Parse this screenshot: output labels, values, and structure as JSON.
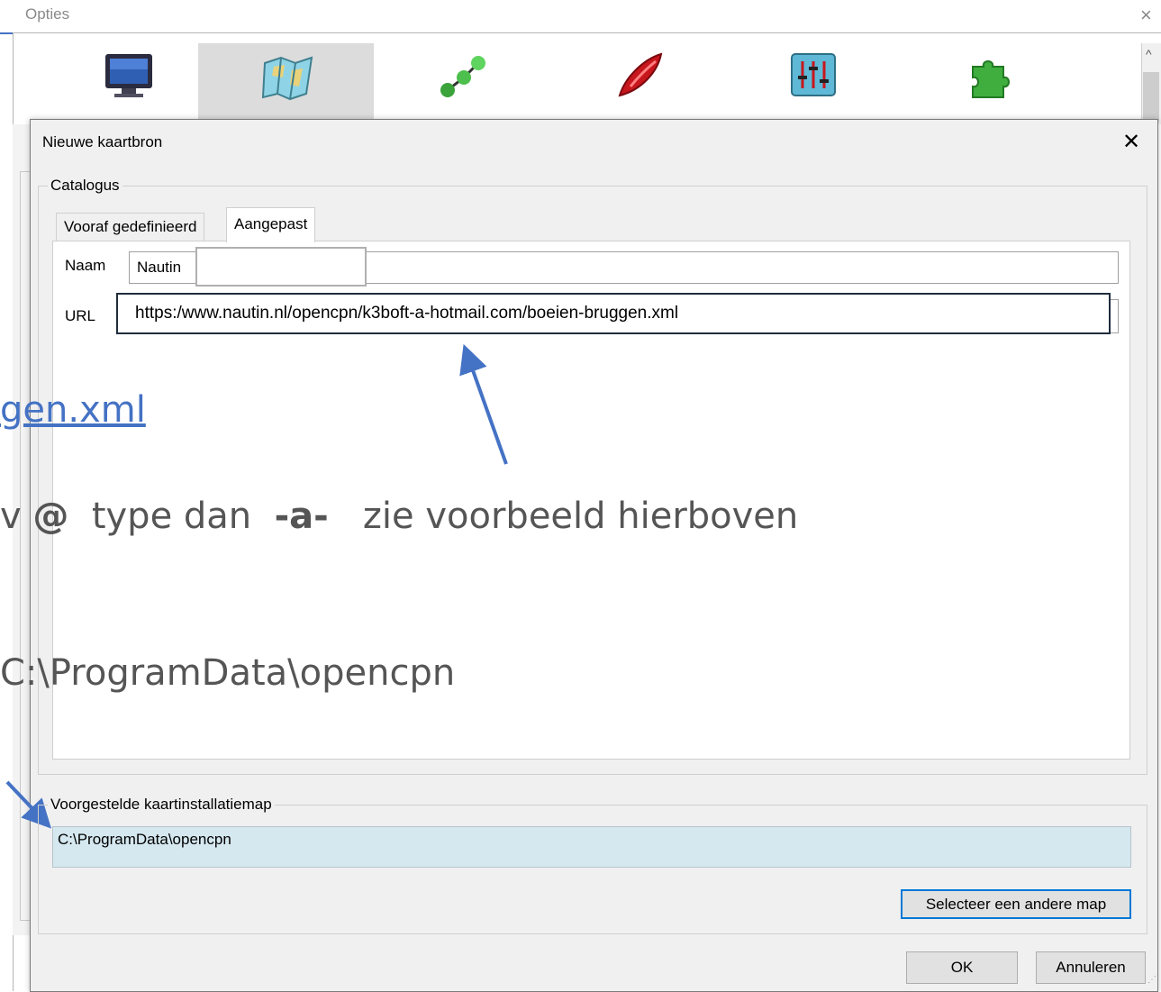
{
  "options_window": {
    "title": "Opties",
    "close": "×",
    "toolbar_icons": [
      "monitor-icon",
      "chart-map-icon",
      "connections-icon",
      "ship-icon",
      "sliders-icon",
      "puzzle-plugin-icon"
    ],
    "scroll_up": "^"
  },
  "dialog": {
    "title": "Nieuwe kaartbron",
    "close": "✕",
    "catalog_group": "Catalogus",
    "tabs": [
      {
        "label": "Vooraf gedefinieerd",
        "active": false
      },
      {
        "label": "Aangepast",
        "active": true
      }
    ],
    "name_label": "Naam",
    "name_value": "Nautin",
    "url_label": "URL",
    "url_value": "https:/www.nautin.nl/opencpn/k3boft-a-hotmail.com/boeien-bruggen.xml",
    "install_group": "Voorgestelde kaartinstallatiemap",
    "install_path": "C:\\ProgramData\\opencpn",
    "select_button": "Selecteer een andere map",
    "ok_button": "OK",
    "cancel_button": "Annuleren"
  },
  "overlay": {
    "link_fragment": "gen.xml",
    "hint_start": "v ",
    "hint_at": "@",
    "hint_mid": "  type dan  ",
    "hint_a": "-a-",
    "hint_end": "   zie voorbeeld hierboven",
    "path_text": "C:\\ProgramData\\opencpn"
  },
  "colors": {
    "accent": "#4472c4",
    "install_field_bg": "#d5e7ef",
    "focus_border": "#0078d7"
  }
}
